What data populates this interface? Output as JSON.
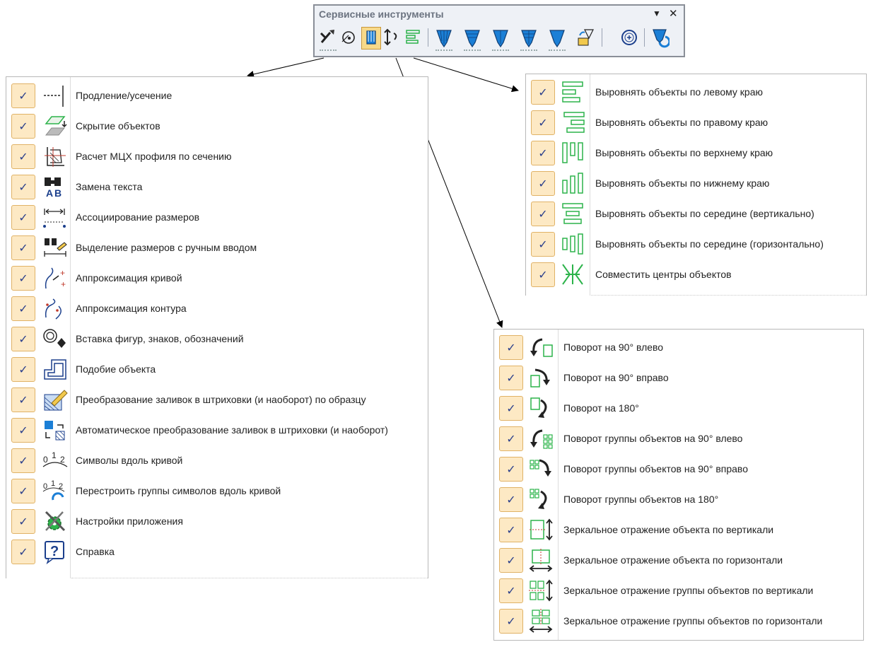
{
  "toolbar": {
    "title": "Сервисные инструменты",
    "menu_arrow": "▼",
    "close": "✕"
  },
  "panel_left": {
    "items": [
      {
        "label": "Продление/усечение",
        "icon": "extend-trim-icon",
        "check": "✓"
      },
      {
        "label": "Скрытие объектов",
        "icon": "hide-objects-icon",
        "check": "✓"
      },
      {
        "label": "Расчет МЦХ профиля по сечению",
        "icon": "section-profile-icon",
        "check": "✓"
      },
      {
        "label": "Замена текста",
        "icon": "replace-text-icon",
        "check": "✓"
      },
      {
        "label": "Ассоциирование размеров",
        "icon": "associate-dimensions-icon",
        "check": "✓"
      },
      {
        "label": "Выделение размеров с ручным вводом",
        "icon": "select-manual-dimensions-icon",
        "check": "✓"
      },
      {
        "label": "Аппроксимация кривой",
        "icon": "approximate-curve-icon",
        "check": "✓"
      },
      {
        "label": "Аппроксимация контура",
        "icon": "approximate-contour-icon",
        "check": "✓"
      },
      {
        "label": "Вставка фигур, знаков, обозначений",
        "icon": "insert-shapes-icon",
        "check": "✓"
      },
      {
        "label": "Подобие объекта",
        "icon": "object-similarity-icon",
        "check": "✓"
      },
      {
        "label": "Преобразование заливок в штриховки (и наоборот) по образцу",
        "icon": "fill-to-hatch-sample-icon",
        "check": "✓"
      },
      {
        "label": "Автоматическое преобразование заливок в штриховки (и наоборот)",
        "icon": "fill-to-hatch-auto-icon",
        "check": "✓"
      },
      {
        "label": "Символы вдоль кривой",
        "icon": "symbols-along-curve-icon",
        "check": "✓"
      },
      {
        "label": "Перестроить группы символов вдоль кривой",
        "icon": "rebuild-symbols-icon",
        "check": "✓"
      },
      {
        "label": "Настройки приложения",
        "icon": "app-settings-icon",
        "check": "✓"
      },
      {
        "label": "Справка",
        "icon": "help-icon",
        "check": "✓"
      }
    ]
  },
  "panel_align": {
    "items": [
      {
        "label": "Выровнять объекты по левому краю",
        "icon": "align-left-icon",
        "check": "✓"
      },
      {
        "label": "Выровнять объекты по правому краю",
        "icon": "align-right-icon",
        "check": "✓"
      },
      {
        "label": "Выровнять объекты по верхнему краю",
        "icon": "align-top-icon",
        "check": "✓"
      },
      {
        "label": "Выровнять объекты по нижнему краю",
        "icon": "align-bottom-icon",
        "check": "✓"
      },
      {
        "label": "Выровнять объекты по середине (вертикально)",
        "icon": "align-middle-vertical-icon",
        "check": "✓"
      },
      {
        "label": "Выровнять объекты по середине (горизонтально)",
        "icon": "align-middle-horizontal-icon",
        "check": "✓"
      },
      {
        "label": "Совместить центры объектов",
        "icon": "align-centers-icon",
        "check": "✓"
      }
    ]
  },
  "panel_rotate": {
    "items": [
      {
        "label": "Поворот на 90° влево",
        "icon": "rotate-90-left-icon",
        "check": "✓"
      },
      {
        "label": "Поворот на 90° вправо",
        "icon": "rotate-90-right-icon",
        "check": "✓"
      },
      {
        "label": "Поворот на 180°",
        "icon": "rotate-180-icon",
        "check": "✓"
      },
      {
        "label": "Поворот группы объектов на 90° влево",
        "icon": "rotate-group-90-left-icon",
        "check": "✓"
      },
      {
        "label": "Поворот группы объектов на 90° вправо",
        "icon": "rotate-group-90-right-icon",
        "check": "✓"
      },
      {
        "label": "Поворот группы объектов на 180°",
        "icon": "rotate-group-180-icon",
        "check": "✓"
      },
      {
        "label": "Зеркальное отражение объекта по вертикали",
        "icon": "mirror-vertical-icon",
        "check": "✓"
      },
      {
        "label": "Зеркальное отражение объекта по горизонтали",
        "icon": "mirror-horizontal-icon",
        "check": "✓"
      },
      {
        "label": "Зеркальное отражение группы объектов по вертикали",
        "icon": "mirror-group-vertical-icon",
        "check": "✓"
      },
      {
        "label": "Зеркальное отражение группы объектов по горизонтали",
        "icon": "mirror-group-horizontal-icon",
        "check": "✓"
      }
    ]
  },
  "colors": {
    "check_bg": "#fde9c4",
    "check_border": "#e0b266",
    "accent_blue": "#1b7fd6",
    "accent_green": "#2cb34a"
  }
}
